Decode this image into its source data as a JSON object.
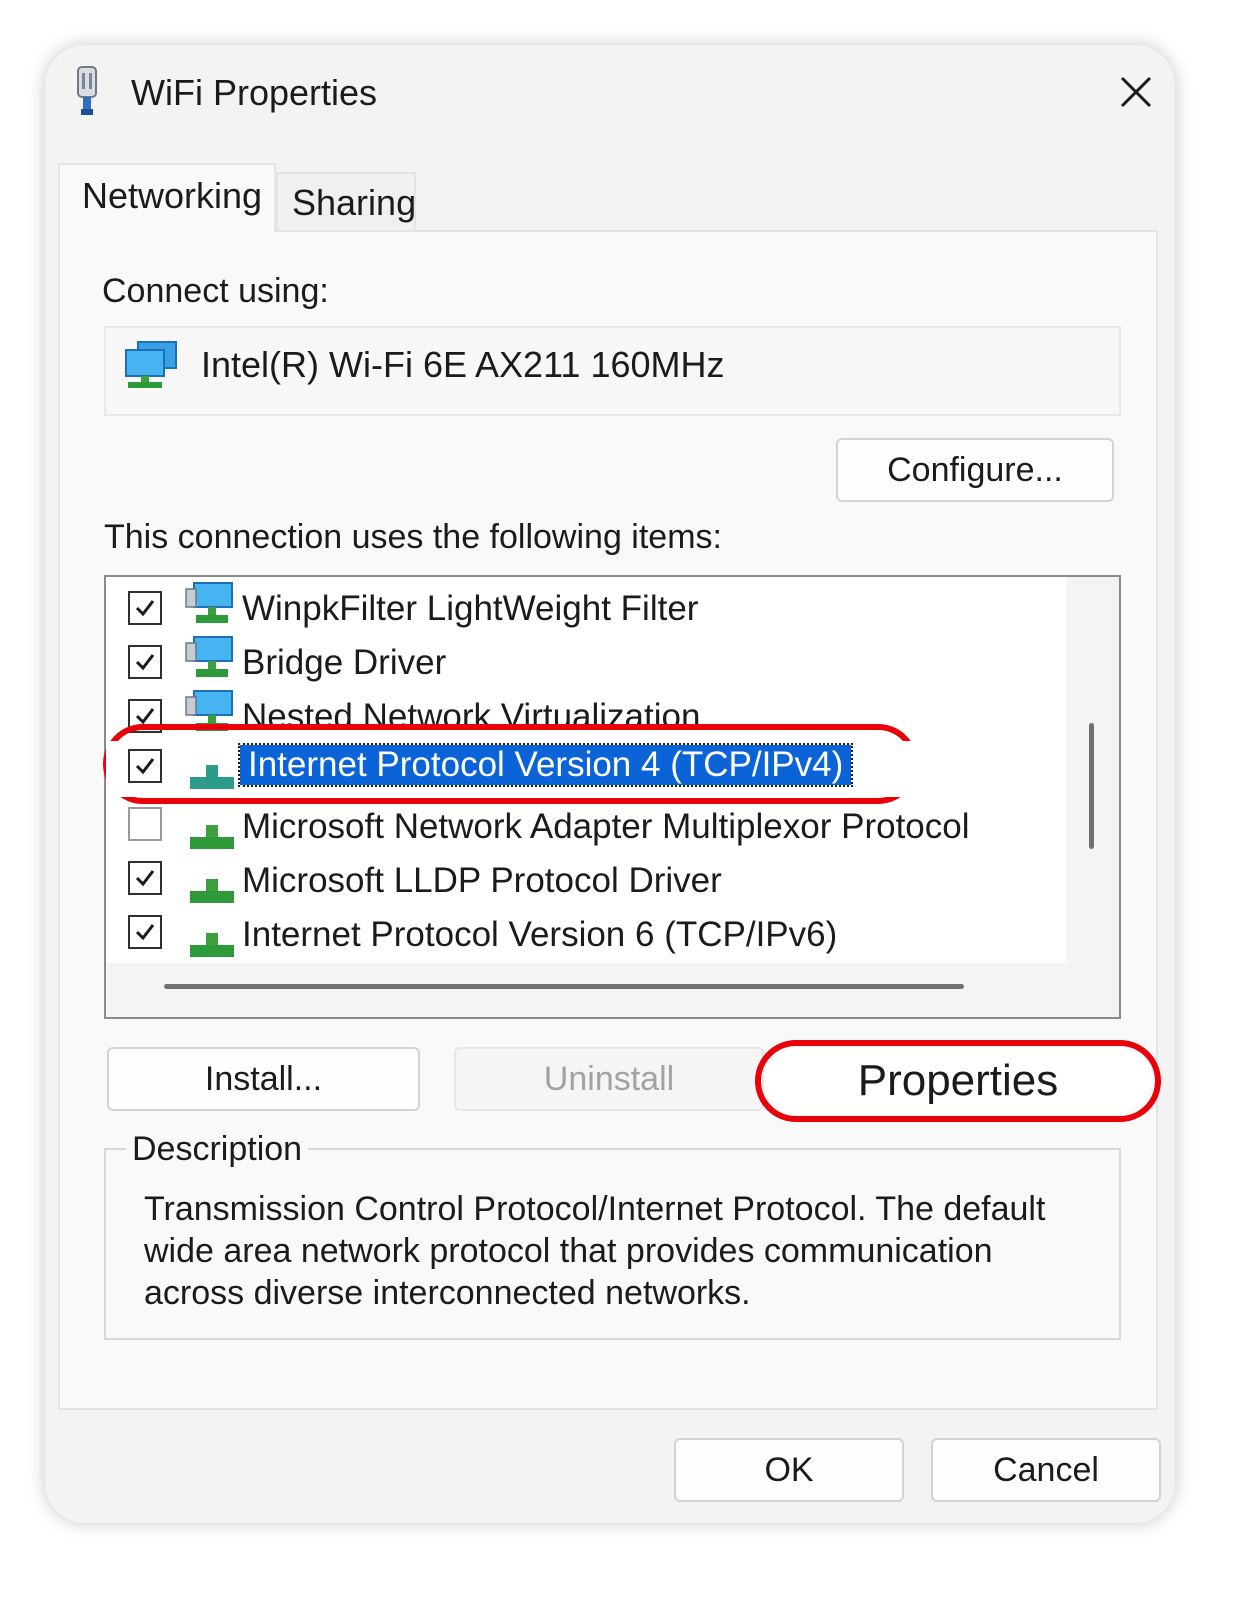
{
  "window": {
    "title": "WiFi Properties",
    "title_icon": "network-adapter-icon",
    "close_icon": "close-icon"
  },
  "tabs": [
    {
      "label": "Networking",
      "active": true
    },
    {
      "label": "Sharing",
      "active": false
    }
  ],
  "connect_using": {
    "label": "Connect using:",
    "adapter_name": "Intel(R) Wi-Fi 6E AX211 160MHz",
    "adapter_icon": "network-adapter-icon",
    "configure_label": "Configure..."
  },
  "items_section": {
    "label": "This connection uses the following items:",
    "items": [
      {
        "label": "WinpkFilter LightWeight Filter",
        "checked": true,
        "icon": "network-service-icon",
        "selected": false
      },
      {
        "label": "Bridge Driver",
        "checked": true,
        "icon": "network-service-icon",
        "selected": false
      },
      {
        "label": "Nested Network Virtualization",
        "checked": true,
        "icon": "network-service-icon",
        "selected": false
      },
      {
        "label": "Internet Protocol Version 4 (TCP/IPv4)",
        "checked": true,
        "icon": "protocol-icon",
        "selected": true
      },
      {
        "label": "Microsoft Network Adapter Multiplexor Protocol",
        "checked": false,
        "icon": "protocol-icon",
        "selected": false
      },
      {
        "label": "Microsoft LLDP Protocol Driver",
        "checked": true,
        "icon": "protocol-icon",
        "selected": false
      },
      {
        "label": "Internet Protocol Version 6 (TCP/IPv6)",
        "checked": true,
        "icon": "protocol-icon",
        "selected": false
      }
    ]
  },
  "action_buttons": {
    "install": "Install...",
    "uninstall": "Uninstall",
    "properties": "Properties"
  },
  "description": {
    "legend": "Description",
    "text": "Transmission Control Protocol/Internet Protocol. The default wide area network protocol that provides communication across diverse interconnected networks."
  },
  "footer": {
    "ok": "OK",
    "cancel": "Cancel"
  },
  "colors": {
    "selection": "#0a64d8",
    "annotation_red": "#e8000b",
    "dialog_background": "#f3f3f3"
  }
}
